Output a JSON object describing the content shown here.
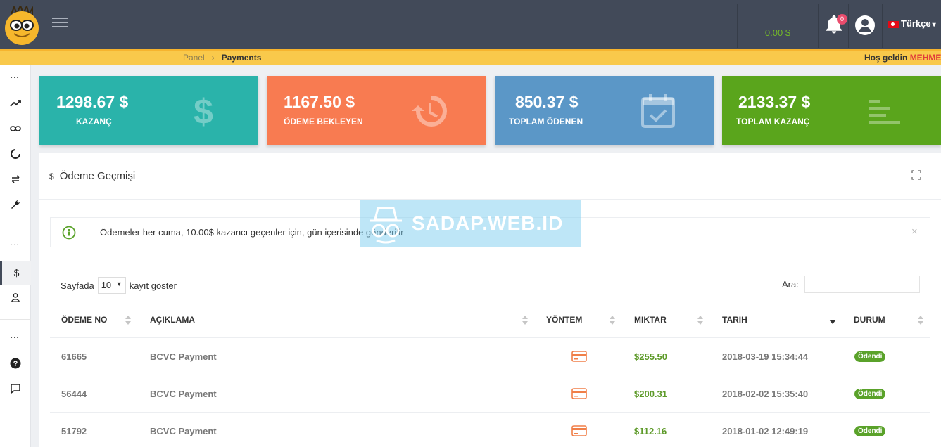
{
  "header": {
    "balance": "0.00 $",
    "notification_count": "0",
    "language": "Türkçe"
  },
  "breadcrumb": {
    "root": "Panel",
    "current": "Payments"
  },
  "welcome": {
    "greeting": "Hoş geldin",
    "name": "MEHME"
  },
  "sidebar": {
    "section_marker": "...",
    "items": [
      {
        "icon": "trending-up-icon"
      },
      {
        "icon": "link-icon"
      },
      {
        "icon": "loader-icon"
      },
      {
        "icon": "swap-icon"
      },
      {
        "icon": "wrench-icon"
      },
      {
        "icon": "dollar-icon",
        "active": true
      },
      {
        "icon": "user-icon"
      },
      {
        "icon": "help-icon"
      },
      {
        "icon": "chat-icon"
      }
    ]
  },
  "stats": [
    {
      "value": "1298.67 $",
      "label": "KAZANÇ",
      "color": "#2ab3aa",
      "icon": "dollar-icon"
    },
    {
      "value": "1167.50 $",
      "label": "ÖDEME BEKLEYEN",
      "color": "#f87b51",
      "icon": "history-icon"
    },
    {
      "value": "850.37 $",
      "label": "TOPLAM ÖDENEN",
      "color": "#5b97c7",
      "icon": "calendar-check-icon"
    },
    {
      "value": "2133.37 $",
      "label": "TOPLAM KAZANÇ",
      "color": "#5aa51c",
      "icon": "bars-icon"
    }
  ],
  "panel": {
    "title_icon": "$",
    "title": "Ödeme Geçmişi",
    "alert": "Ödemeler her cuma, 10.00$ kazancı geçenler için, gün içerisinde gönderilir",
    "alert_close": "×",
    "watermark": "SADAP.WEB.ID",
    "length_prefix": "Sayfada",
    "length_value": "10",
    "length_suffix": "kayıt göster",
    "search_label": "Ara:",
    "search_value": "",
    "columns": [
      "ÖDEME NO",
      "AÇIKLAMA",
      "YÖNTEM",
      "MIKTAR",
      "TARIH",
      "DURUM"
    ],
    "rows": [
      {
        "no": "61665",
        "desc": "BCVC Payment",
        "method": "card-icon",
        "amount": "$255.50",
        "date": "2018-03-19 15:34:44",
        "status": "Ödendi"
      },
      {
        "no": "56444",
        "desc": "BCVC Payment",
        "method": "card-icon",
        "amount": "$200.31",
        "date": "2018-02-02 15:35:40",
        "status": "Ödendi"
      },
      {
        "no": "51792",
        "desc": "BCVC Payment",
        "method": "card-icon",
        "amount": "$112.16",
        "date": "2018-01-02 12:49:19",
        "status": "Ödendi"
      }
    ]
  }
}
